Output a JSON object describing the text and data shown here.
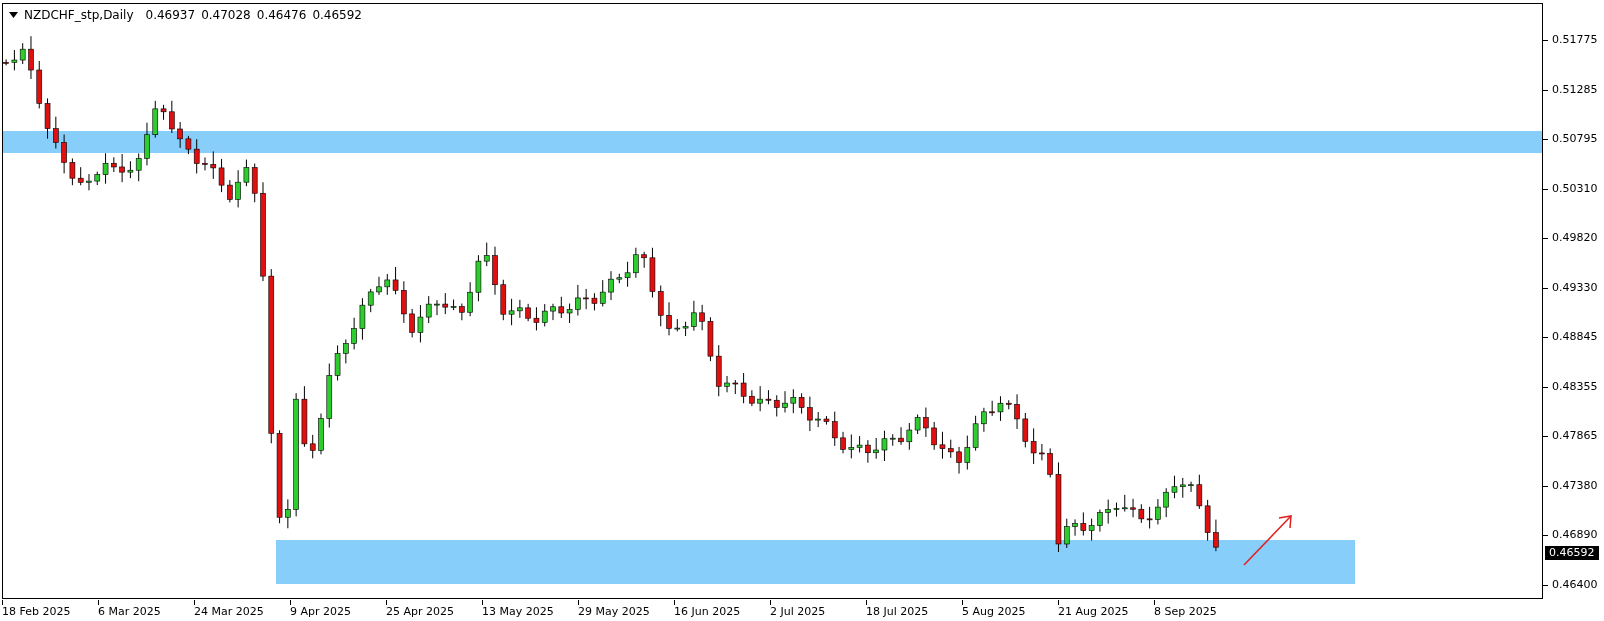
{
  "header": {
    "symbol": "NZDCHF_stp,Daily",
    "prices": [
      "0.46937",
      "0.47028",
      "0.46476",
      "0.46592"
    ]
  },
  "price_axis": {
    "labels": [
      "0.51775",
      "0.51285",
      "0.50795",
      "0.50310",
      "0.49820",
      "0.49330",
      "0.48845",
      "0.48355",
      "0.47865",
      "0.47380",
      "0.46890",
      "0.46400"
    ],
    "current_price": "0.46592"
  },
  "time_axis": {
    "labels": [
      "18 Feb 2025",
      "6 Mar 2025",
      "24 Mar 2025",
      "9 Apr 2025",
      "25 Apr 2025",
      "13 May 2025",
      "29 May 2025",
      "16 Jun 2025",
      "2 Jul 2025",
      "18 Jul 2025",
      "5 Aug 2025",
      "21 Aug 2025",
      "8 Sep 2025"
    ]
  }
}
